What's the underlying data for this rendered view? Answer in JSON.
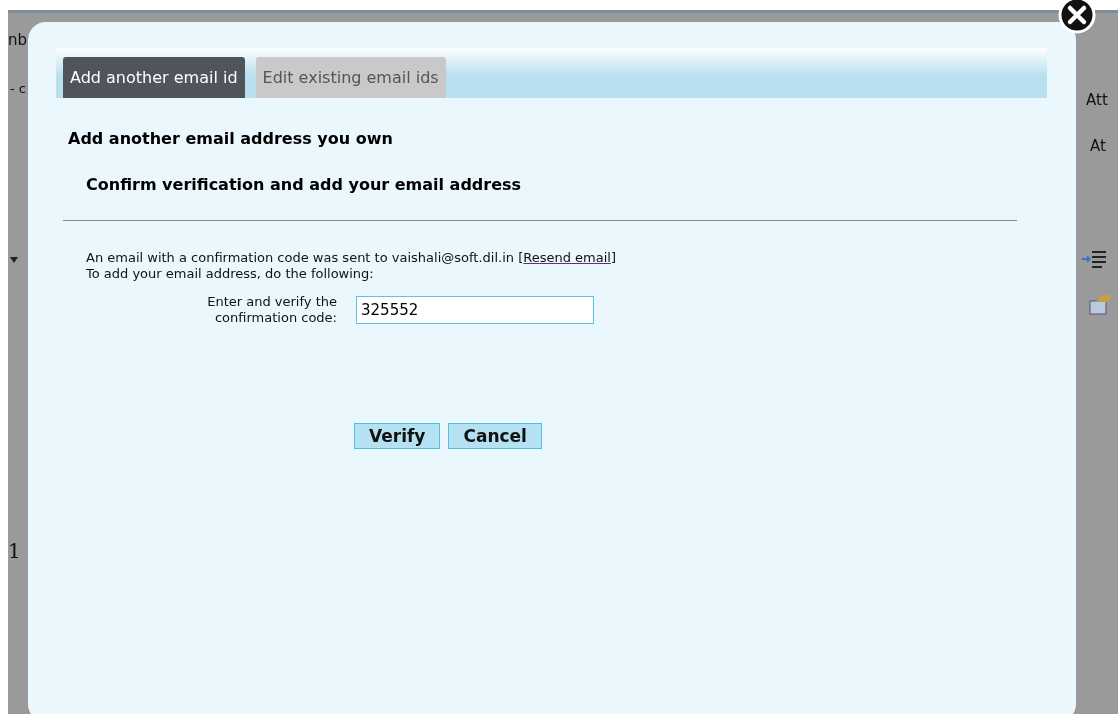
{
  "background": {
    "left_texts": [
      "nb",
      "- c",
      "1"
    ],
    "right_texts": [
      "Att",
      "At"
    ]
  },
  "dialog": {
    "tabs": [
      {
        "label": "Add another email id",
        "selected": true
      },
      {
        "label": "Edit existing email ids",
        "selected": false
      }
    ],
    "heading": "Add another email address you own",
    "subheading": "Confirm verification and add your email address",
    "message": {
      "before": "An email with a confirmation code was sent to vaishali@soft.dil.in [",
      "link": "Resend email",
      "after": "]"
    },
    "instruction": "To add your email address, do the following:",
    "code_field": {
      "label": "Enter and verify the confirmation code:",
      "value": "325552"
    },
    "buttons": [
      "Verify",
      "Cancel"
    ]
  }
}
